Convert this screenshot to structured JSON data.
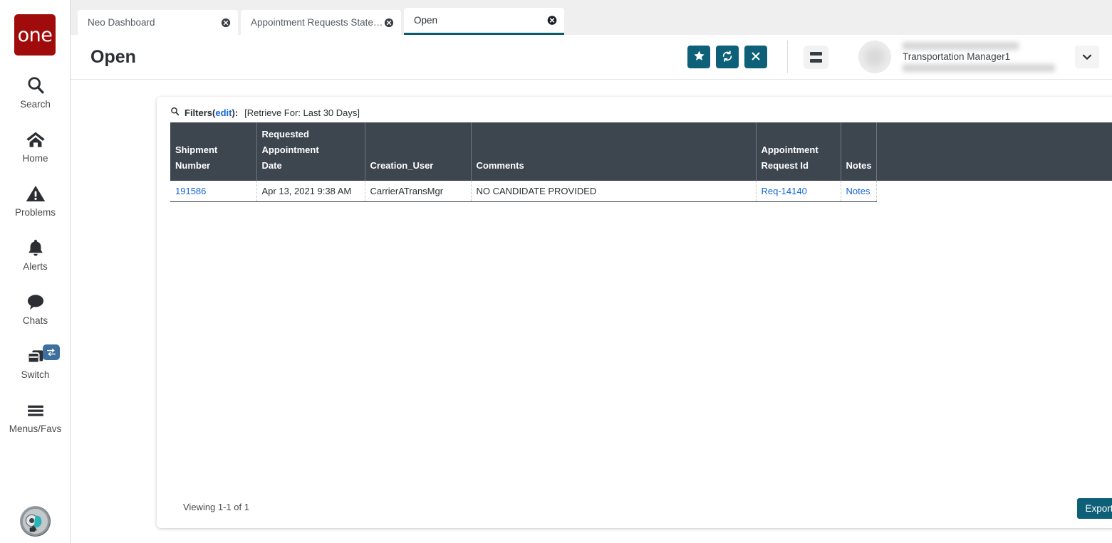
{
  "brand": {
    "logo_text": "one",
    "logo_color": "#a00b0b"
  },
  "sidebar": {
    "items": [
      {
        "label": "Search",
        "icon": "search-icon"
      },
      {
        "label": "Home",
        "icon": "home-icon"
      },
      {
        "label": "Problems",
        "icon": "warning-triangle-icon"
      },
      {
        "label": "Alerts",
        "icon": "bell-icon"
      },
      {
        "label": "Chats",
        "icon": "chat-bubble-icon"
      },
      {
        "label": "Switch",
        "icon": "switch-windows-icon",
        "badge_icon": "swap-arrows-icon"
      },
      {
        "label": "Menus/Favs",
        "icon": "hamburger-icon"
      }
    ],
    "bottom_avatar": "user-avatar-image"
  },
  "tabs": [
    {
      "label": "Neo Dashboard",
      "active": false
    },
    {
      "label": "Appointment Requests State Su...",
      "active": false
    },
    {
      "label": "Open",
      "active": true
    }
  ],
  "header": {
    "title": "Open",
    "actions": [
      {
        "name": "favorite-button",
        "icon": "star-icon"
      },
      {
        "name": "refresh-button",
        "icon": "refresh-icon"
      },
      {
        "name": "close-button",
        "icon": "x-icon"
      }
    ],
    "menu_button_icon": "list-menu-icon",
    "user": {
      "name": "Transportation Manager1",
      "line_above": "",
      "line_below": ""
    },
    "chevron_icon": "chevron-down-icon"
  },
  "filters": {
    "icon": "search-icon",
    "label": "Filters",
    "edit_label": "edit",
    "open_paren": "(",
    "close_paren": "):",
    "retrieve": "[Retrieve For: Last 30 Days]"
  },
  "table": {
    "columns": [
      "Shipment Number",
      "Requested Appointment Date",
      "Creation_User",
      "Comments",
      "Appointment Request Id",
      "Notes",
      ""
    ],
    "columns_wrapped": [
      [
        "",
        "Shipment Number"
      ],
      [
        "Requested Appointment",
        "Date"
      ],
      [
        "",
        "Creation_User"
      ],
      [
        "",
        "Comments"
      ],
      [
        "Appointment",
        "Request Id"
      ],
      [
        "",
        "Notes"
      ],
      [
        "",
        ""
      ]
    ],
    "rows": [
      {
        "shipment_number": "191586",
        "requested_appointment_date": "Apr 13, 2021 9:38 AM",
        "creation_user": "CarrierATransMgr",
        "comments": "NO CANDIDATE PROVIDED",
        "appointment_request_id": "Req-14140",
        "notes": "Notes"
      }
    ]
  },
  "footer": {
    "viewing": "Viewing 1-1 of 1",
    "export_label": "Export to CSV"
  },
  "colors": {
    "accent": "#0d6078",
    "table_header": "#3d454f",
    "link": "#1565d8",
    "brand_red": "#a00b0b",
    "badge_blue": "#3e6f9e"
  }
}
